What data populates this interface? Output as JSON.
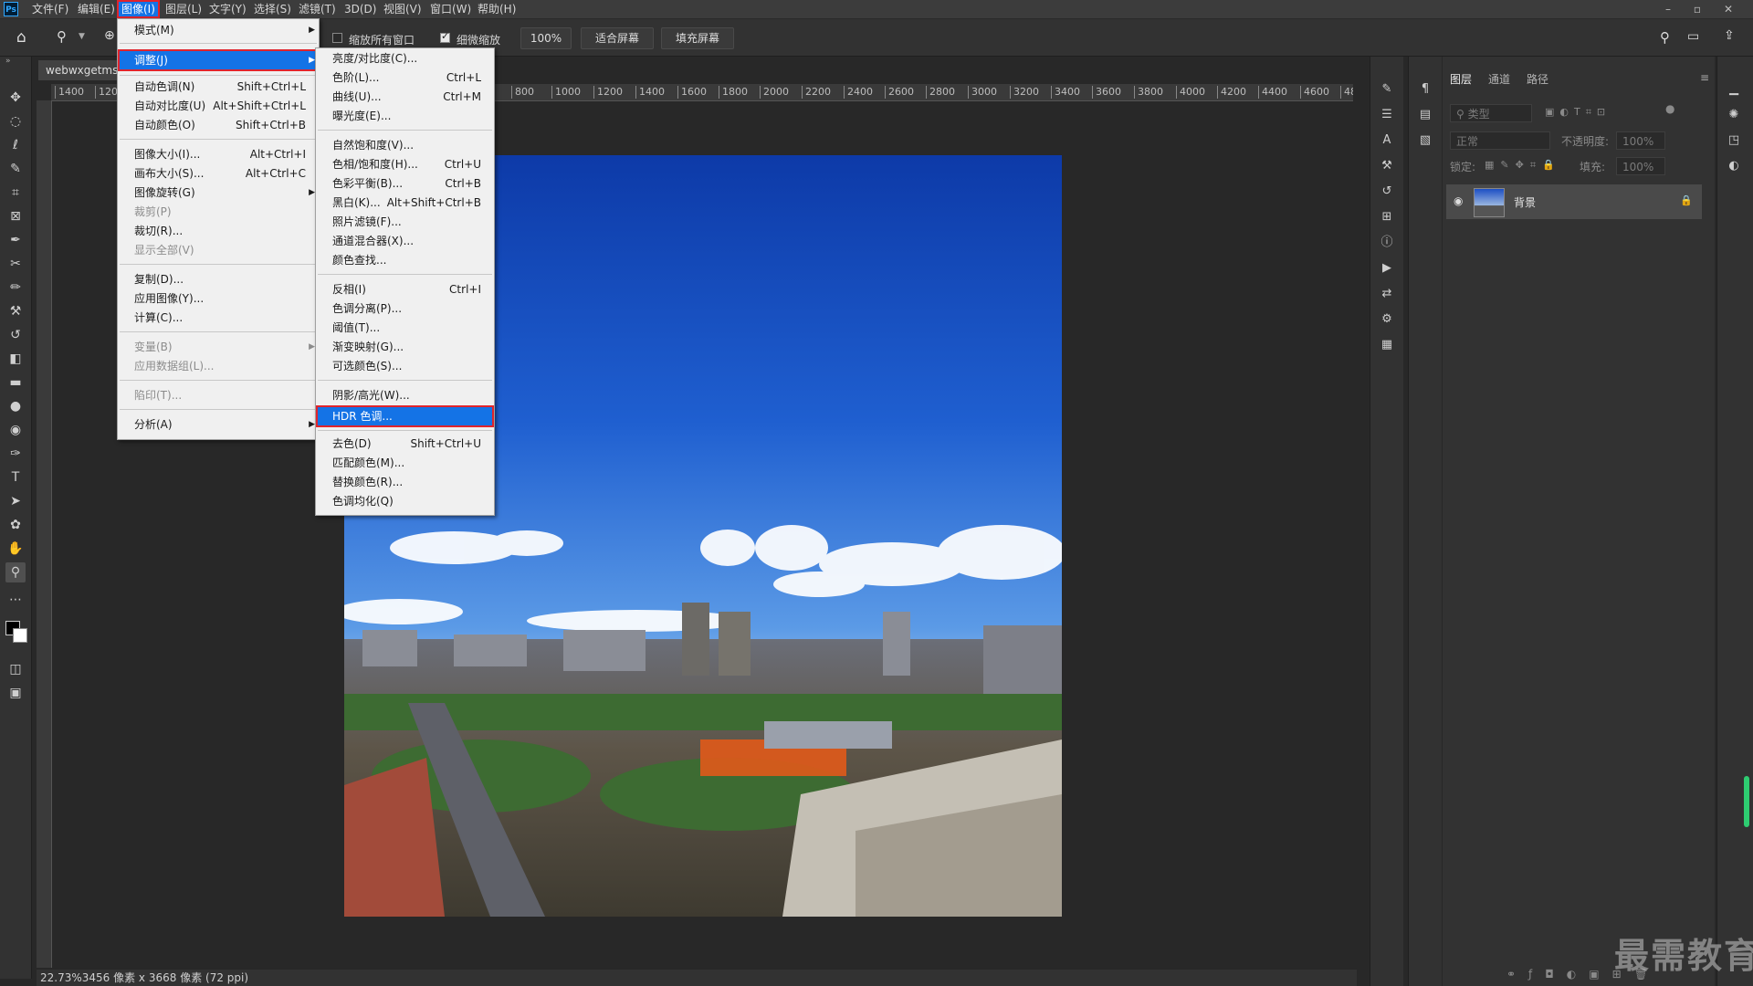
{
  "app": {
    "logo": "Ps"
  },
  "menubar": {
    "items": [
      "文件(F)",
      "编辑(E)",
      "图像(I)",
      "图层(L)",
      "文字(Y)",
      "选择(S)",
      "滤镜(T)",
      "3D(D)",
      "视图(V)",
      "窗口(W)",
      "帮助(H)"
    ],
    "window_controls": [
      "–",
      "▫",
      "✕"
    ]
  },
  "options": {
    "zoom_all_windows": "缩放所有窗口",
    "scrubby_zoom": "细微缩放",
    "zoom_percent": "100%",
    "fit_screen": "适合屏幕",
    "fill_screen": "填充屏幕"
  },
  "document": {
    "tab_title": "webwxgetms",
    "status": "22.73%3456 像素 x 3668 像素 (72 ppi)",
    "ruler_ticks": [
      "1400",
      "120",
      "800",
      "1000",
      "1200",
      "1400",
      "1600",
      "1800",
      "2000",
      "2200",
      "2400",
      "2600",
      "2800",
      "3000",
      "3200",
      "3400",
      "3600",
      "3800",
      "4000",
      "4200",
      "4400",
      "4600",
      "48"
    ]
  },
  "image_menu": {
    "items": [
      {
        "label": "模式(M)",
        "shortcut": "",
        "submenu": true,
        "disabled": false
      },
      {
        "label": "调整(J)",
        "shortcut": "",
        "submenu": true,
        "disabled": false,
        "highlighted": true
      },
      {
        "label": "自动色调(N)",
        "shortcut": "Shift+Ctrl+L",
        "submenu": false,
        "disabled": false
      },
      {
        "label": "自动对比度(U)",
        "shortcut": "Alt+Shift+Ctrl+L",
        "submenu": false,
        "disabled": false
      },
      {
        "label": "自动颜色(O)",
        "shortcut": "Shift+Ctrl+B",
        "submenu": false,
        "disabled": false
      },
      {
        "label": "图像大小(I)...",
        "shortcut": "Alt+Ctrl+I",
        "submenu": false,
        "disabled": false
      },
      {
        "label": "画布大小(S)...",
        "shortcut": "Alt+Ctrl+C",
        "submenu": false,
        "disabled": false
      },
      {
        "label": "图像旋转(G)",
        "shortcut": "",
        "submenu": true,
        "disabled": false
      },
      {
        "label": "裁剪(P)",
        "shortcut": "",
        "submenu": false,
        "disabled": true
      },
      {
        "label": "裁切(R)...",
        "shortcut": "",
        "submenu": false,
        "disabled": false
      },
      {
        "label": "显示全部(V)",
        "shortcut": "",
        "submenu": false,
        "disabled": true
      },
      {
        "label": "复制(D)...",
        "shortcut": "",
        "submenu": false,
        "disabled": false
      },
      {
        "label": "应用图像(Y)...",
        "shortcut": "",
        "submenu": false,
        "disabled": false
      },
      {
        "label": "计算(C)...",
        "shortcut": "",
        "submenu": false,
        "disabled": false
      },
      {
        "label": "变量(B)",
        "shortcut": "",
        "submenu": true,
        "disabled": true
      },
      {
        "label": "应用数据组(L)...",
        "shortcut": "",
        "submenu": false,
        "disabled": true
      },
      {
        "label": "陷印(T)...",
        "shortcut": "",
        "submenu": false,
        "disabled": true
      },
      {
        "label": "分析(A)",
        "shortcut": "",
        "submenu": true,
        "disabled": false
      }
    ]
  },
  "adjust_menu": {
    "items": [
      {
        "label": "亮度/对比度(C)...",
        "shortcut": ""
      },
      {
        "label": "色阶(L)...",
        "shortcut": "Ctrl+L"
      },
      {
        "label": "曲线(U)...",
        "shortcut": "Ctrl+M"
      },
      {
        "label": "曝光度(E)...",
        "shortcut": ""
      },
      {
        "label": "自然饱和度(V)...",
        "shortcut": ""
      },
      {
        "label": "色相/饱和度(H)...",
        "shortcut": "Ctrl+U"
      },
      {
        "label": "色彩平衡(B)...",
        "shortcut": "Ctrl+B"
      },
      {
        "label": "黑白(K)...",
        "shortcut": "Alt+Shift+Ctrl+B"
      },
      {
        "label": "照片滤镜(F)...",
        "shortcut": ""
      },
      {
        "label": "通道混合器(X)...",
        "shortcut": ""
      },
      {
        "label": "颜色查找...",
        "shortcut": ""
      },
      {
        "label": "反相(I)",
        "shortcut": "Ctrl+I"
      },
      {
        "label": "色调分离(P)...",
        "shortcut": ""
      },
      {
        "label": "阈值(T)...",
        "shortcut": ""
      },
      {
        "label": "渐变映射(G)...",
        "shortcut": ""
      },
      {
        "label": "可选颜色(S)...",
        "shortcut": ""
      },
      {
        "label": "阴影/高光(W)...",
        "shortcut": ""
      },
      {
        "label": "HDR 色调...",
        "shortcut": "",
        "highlighted": true
      },
      {
        "label": "去色(D)",
        "shortcut": "Shift+Ctrl+U"
      },
      {
        "label": "匹配颜色(M)...",
        "shortcut": ""
      },
      {
        "label": "替换颜色(R)...",
        "shortcut": ""
      },
      {
        "label": "色调均化(Q)",
        "shortcut": ""
      }
    ]
  },
  "layers_panel": {
    "tabs": [
      "图层",
      "通道",
      "路径"
    ],
    "filter_placeholder": "类型",
    "blend_mode": "正常",
    "opacity_label": "不透明度:",
    "opacity_value": "100%",
    "lock_label": "锁定:",
    "fill_label": "填充:",
    "fill_value": "100%",
    "layer_name": "背景"
  },
  "watermark": "最需教育",
  "colors": {
    "accent": "#1473e6",
    "highlight_border": "#e0242c",
    "panel": "#323232",
    "canvas": "#282828"
  }
}
